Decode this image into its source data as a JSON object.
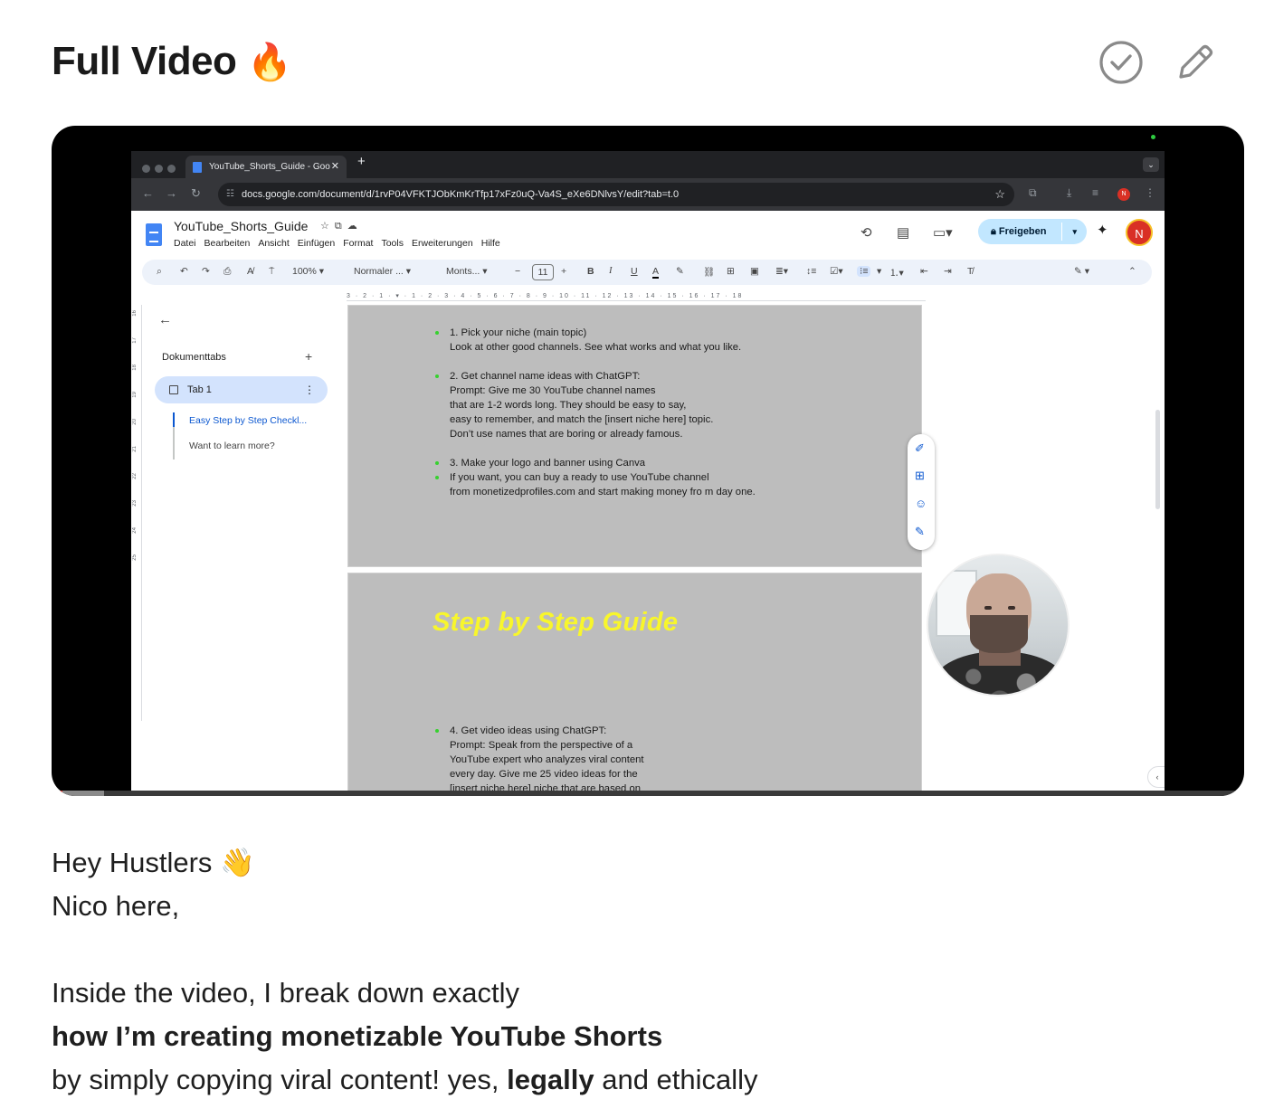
{
  "page": {
    "title": "Full Video",
    "title_emoji": "🔥"
  },
  "actions": {
    "done_icon": "check-circle-icon",
    "edit_icon": "pencil-icon"
  },
  "video": {
    "progress_fraction": 0.009,
    "buffer_fraction": 0.044,
    "browser": {
      "tab_title": "YouTube_Shorts_Guide - Goo",
      "url": "docs.google.com/document/d/1rvP04VFKTJObKmKrTfp17xFz0uQ-Va4S_eXe6DNlvsY/edit?tab=t.0",
      "avatar_letter": "N"
    },
    "docs": {
      "doc_name": "YouTube_Shorts_Guide",
      "menus": [
        "Datei",
        "Bearbeiten",
        "Ansicht",
        "Einfügen",
        "Format",
        "Tools",
        "Erweiterungen",
        "Hilfe"
      ],
      "share_label": "Freigeben",
      "user_initial": "N",
      "toolbar": {
        "zoom": "100%",
        "style": "Normaler ...",
        "font": "Monts...",
        "font_size": "11"
      },
      "ruler_marks": "3 · 2 · 1 · ▾ · 1 · 2 · 3 · 4 · 5 · 6 · 7 · 8 · 9 · 10 · 11 · 12 · 13 · 14 · 15 · 16 · 17 · 18",
      "vruler_marks": [
        "16",
        "17",
        "18",
        "19",
        "20",
        "21",
        "22",
        "23",
        "24",
        "25"
      ],
      "sidebar": {
        "title": "Dokumenttabs",
        "tab_label": "Tab 1",
        "outline": [
          "Easy Step by Step Checkl...",
          "Want to learn more?"
        ]
      },
      "page1_lines": [
        {
          "text": "1. Pick your niche (main topic)",
          "bullet": true
        },
        {
          "text": "Look at other good channels. See what works and what you like.",
          "bullet": false
        },
        {
          "text": "",
          "bullet": false
        },
        {
          "text": "2. Get channel name ideas with ChatGPT:",
          "bullet": true
        },
        {
          "text": "Prompt: Give me 30 YouTube channel names",
          "bullet": false
        },
        {
          "text": "that are 1-2 words long. They should be easy to say,",
          "bullet": false
        },
        {
          "text": "easy to remember, and match the [insert niche here] topic.",
          "bullet": false
        },
        {
          "text": "Don’t use names that are boring or already famous.",
          "bullet": false
        },
        {
          "text": "",
          "bullet": false
        },
        {
          "text": "3. Make your logo and banner using Canva",
          "bullet": true
        },
        {
          "text": "If you want, you can buy a ready to use YouTube channel",
          "bullet": true
        },
        {
          "text": "from monetizedprofiles.com and start making money fro m day one.",
          "bullet": false
        }
      ],
      "page2_heading": "Step by Step Guide",
      "page2_lines": [
        {
          "text": "4. Get video ideas using ChatGPT:",
          "bullet": true
        },
        {
          "text": "Prompt: Speak from the perspective of a",
          "bullet": false
        },
        {
          "text": "YouTube expert who analyzes viral content",
          "bullet": false
        },
        {
          "text": "every day. Give me 25 video ideas for the",
          "bullet": false
        },
        {
          "text": "[insert niche here] niche that are based on",
          "bullet": false
        }
      ]
    }
  },
  "body": {
    "greeting": "Hey Hustlers",
    "greeting_emoji": "👋",
    "line2": "Nico here,",
    "line3": "Inside the video, I break down exactly",
    "line4_bold": "how I’m creating monetizable YouTube Shorts",
    "line5_pre": "by simply copying viral content! yes, ",
    "line5_bold": "legally",
    "line5_post": " and ethically"
  }
}
